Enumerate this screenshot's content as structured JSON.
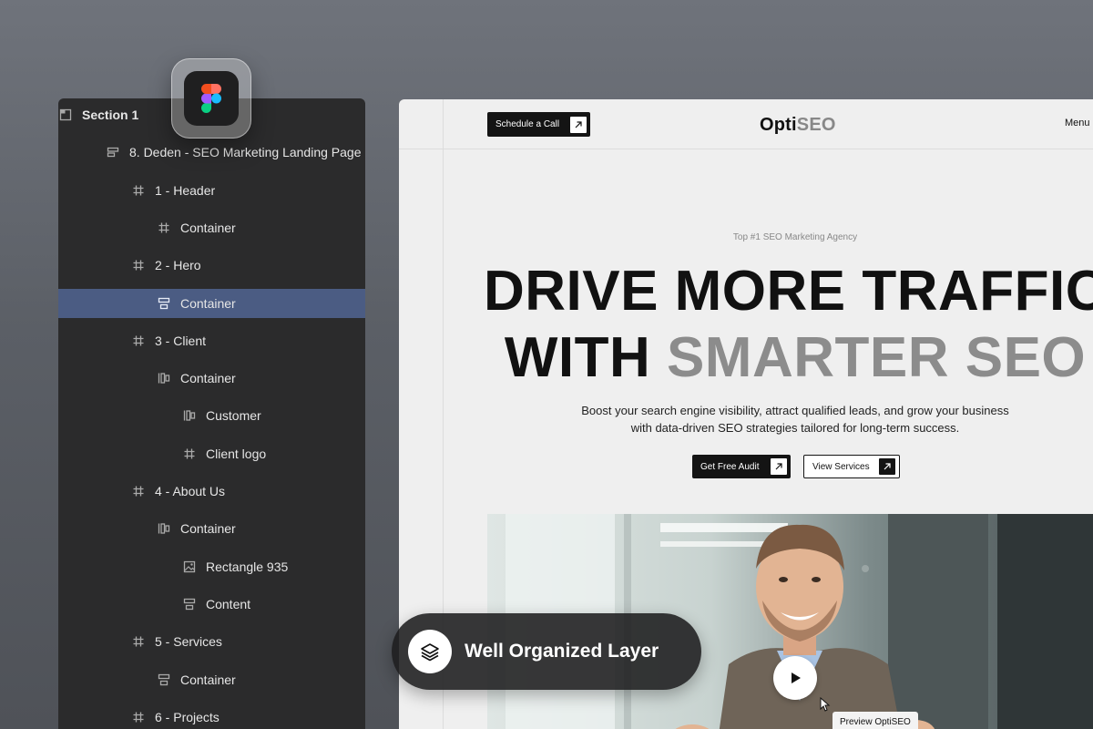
{
  "layers_panel": {
    "items": [
      {
        "label": "Section 1",
        "icon": "section-icon"
      },
      {
        "label": "8. Deden - SEO Marketing Landing Page",
        "icon": "frame-auto-layout-icon"
      },
      {
        "label": "1 - Header",
        "icon": "hash-frame-icon"
      },
      {
        "label": "Container",
        "icon": "hash-frame-icon"
      },
      {
        "label": "2 - Hero",
        "icon": "hash-frame-icon"
      },
      {
        "label": "Container",
        "icon": "vertical-stack-icon",
        "selected": true
      },
      {
        "label": "3 - Client",
        "icon": "hash-frame-icon"
      },
      {
        "label": "Container",
        "icon": "horizontal-stack-icon"
      },
      {
        "label": "Customer",
        "icon": "horizontal-stack-icon"
      },
      {
        "label": "Client logo",
        "icon": "hash-frame-icon"
      },
      {
        "label": "4 - About Us",
        "icon": "hash-frame-icon"
      },
      {
        "label": "Container",
        "icon": "horizontal-stack-icon"
      },
      {
        "label": "Rectangle 935",
        "icon": "image-icon"
      },
      {
        "label": "Content",
        "icon": "vertical-stack-icon"
      },
      {
        "label": "5 - Services",
        "icon": "hash-frame-icon"
      },
      {
        "label": "Container",
        "icon": "vertical-stack-icon"
      },
      {
        "label": "6 - Projects",
        "icon": "hash-frame-icon"
      }
    ]
  },
  "site": {
    "header": {
      "cta": "Schedule a Call",
      "logo_part1": "Opti",
      "logo_part2": "SEO",
      "menu": "Menu"
    },
    "hero": {
      "eyebrow": "Top #1 SEO Marketing Agency",
      "headline_line1": "DRIVE MORE TRAFFIC",
      "headline_line2_dark": "WITH",
      "headline_line2_grey": "SMARTER SEO",
      "subtext_line1": "Boost your search engine visibility, attract qualified leads, and grow your business",
      "subtext_line2": "with data-driven SEO strategies tailored for long-term success.",
      "primary_button": "Get Free Audit",
      "secondary_button": "View Services"
    },
    "video": {
      "preview_label": "Preview OptiSEO"
    }
  },
  "overlay": {
    "label": "Well Organized Layer"
  },
  "colors": {
    "panel_bg": "#2b2b2c",
    "selected_row": "#4b5c83",
    "site_bg": "#efefef",
    "headline_grey": "#8c8c8c"
  }
}
